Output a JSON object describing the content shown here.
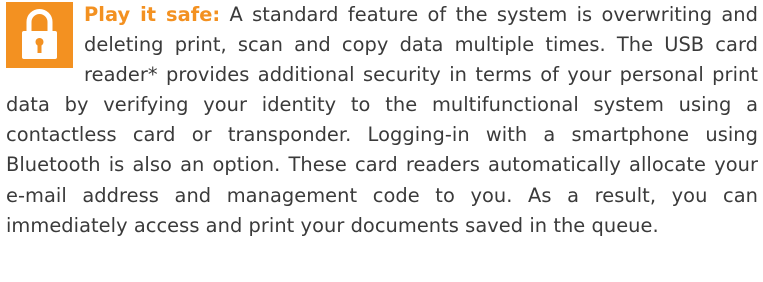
{
  "icons": {
    "lock": "lock-icon"
  },
  "colors": {
    "accent": "#f39121",
    "text": "#3a3a3a",
    "background": "#ffffff"
  },
  "paragraph": {
    "lead": "Play it safe:",
    "body": " A standard feature of the system is overwriting and deleting print, scan and copy data multiple times. The USB card reader* provides additional security in terms of your personal print data by verifying your identity to the multifunctional system using a contactless card or transponder. Logging-in with a smartphone using Bluetooth is also an option. These card readers automatically allocate your e-mail address and management code to you. As a result, you can immediately access and print your documents saved in the queue."
  }
}
